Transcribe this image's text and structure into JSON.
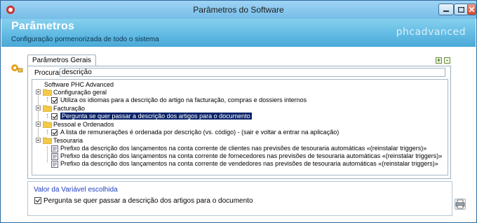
{
  "window": {
    "title": "Parâmetros do Software"
  },
  "header": {
    "title": "Parâmetros",
    "subtitle": "Configuração pormenorizada de todo o sistema",
    "brand": "phcadvanced"
  },
  "tabs": [
    {
      "label": "Parâmetros Gerais"
    }
  ],
  "search": {
    "label": "Procurar :",
    "value": "descrição"
  },
  "tree": {
    "root": "Software PHC Advanced",
    "groups": [
      {
        "label": "Configuração geral",
        "items": [
          "Utiliza os idiomas para a descrição do artigo na facturação, compras e dossiers internos"
        ]
      },
      {
        "label": "Facturação",
        "items": [
          "Pergunta se quer passar a descrição dos artigos para o documento"
        ]
      },
      {
        "label": "Pessoal e Ordenados",
        "items": [
          "A lista de remunerações é ordenada por descrição (vs. código) - (sair e voltar a entrar na aplicação)"
        ]
      },
      {
        "label": "Tesouraria",
        "items": [
          "Prefixo da descrição dos lançamentos na conta corrente de clientes nas previsões de tesouraria automáticas «(reinstalar triggers)»",
          "Prefixo da descrição dos lançamentos na conta corrente de fornecedores nas previsões de tesouraria automáticas «(reinstalar triggers)»",
          "Prefixo da descrição dos lançamentos na conta corrente de vendedores nas previsões de tesouraria automáticas «(reinstalar triggers)»"
        ]
      }
    ]
  },
  "value_panel": {
    "label": "Valor da Variável escolhida",
    "checkbox_label": "Pergunta se quer passar a descrição dos artigos para o documento"
  },
  "icons": [
    "app-icon",
    "minimize-icon",
    "maximize-icon",
    "close-icon",
    "settings-icon",
    "folder-icon",
    "checkbox-icon",
    "document-icon",
    "printer-icon"
  ],
  "colors": {
    "header": "#5fb9e2",
    "selection": "#0a246a",
    "value_label": "#1f3fc0"
  }
}
